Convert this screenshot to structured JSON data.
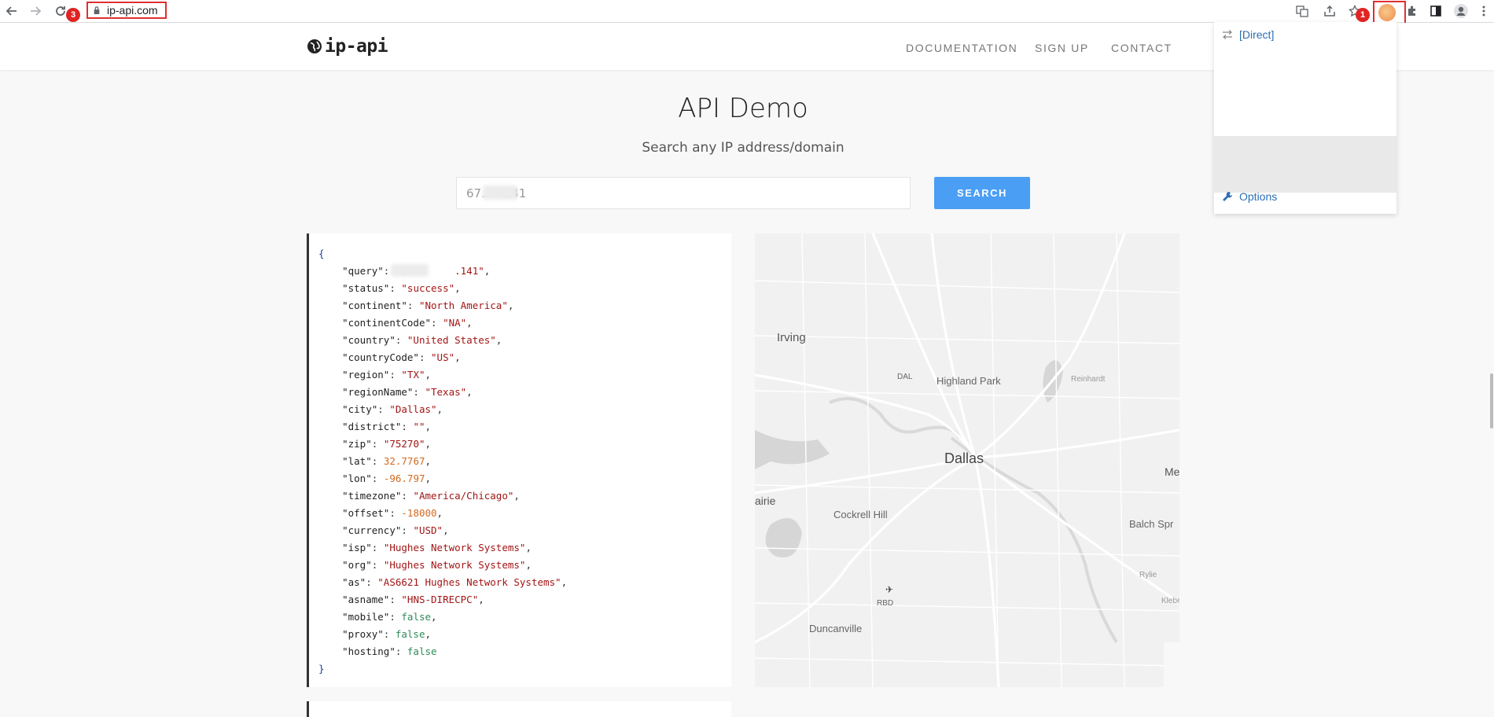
{
  "browser": {
    "url": "ip-api.com",
    "badges": {
      "url_badge": "3",
      "extension_badge": "1"
    }
  },
  "header": {
    "logo_text": "ip-api",
    "nav": [
      {
        "label": "DOCUMENTATION"
      },
      {
        "label": "SIGN UP"
      },
      {
        "label": "CONTACT"
      }
    ]
  },
  "main": {
    "title": "API Demo",
    "subtitle": "Search any IP address/domain",
    "search": {
      "value": "67.    .141",
      "button": "SEARCH"
    }
  },
  "json_result": {
    "open": "{",
    "close": "}",
    "fields": [
      {
        "key": "\"query\"",
        "value": "\"67.      .141\"",
        "type": "s",
        "comma": ","
      },
      {
        "key": "\"status\"",
        "value": "\"success\"",
        "type": "s",
        "comma": ","
      },
      {
        "key": "\"continent\"",
        "value": "\"North America\"",
        "type": "s",
        "comma": ","
      },
      {
        "key": "\"continentCode\"",
        "value": "\"NA\"",
        "type": "s",
        "comma": ","
      },
      {
        "key": "\"country\"",
        "value": "\"United States\"",
        "type": "s",
        "comma": ","
      },
      {
        "key": "\"countryCode\"",
        "value": "\"US\"",
        "type": "s",
        "comma": ","
      },
      {
        "key": "\"region\"",
        "value": "\"TX\"",
        "type": "s",
        "comma": ","
      },
      {
        "key": "\"regionName\"",
        "value": "\"Texas\"",
        "type": "s",
        "comma": ","
      },
      {
        "key": "\"city\"",
        "value": "\"Dallas\"",
        "type": "s",
        "comma": ","
      },
      {
        "key": "\"district\"",
        "value": "\"\"",
        "type": "s",
        "comma": ","
      },
      {
        "key": "\"zip\"",
        "value": "\"75270\"",
        "type": "s",
        "comma": ","
      },
      {
        "key": "\"lat\"",
        "value": "32.7767",
        "type": "n",
        "comma": ","
      },
      {
        "key": "\"lon\"",
        "value": "-96.797",
        "type": "n",
        "comma": ","
      },
      {
        "key": "\"timezone\"",
        "value": "\"America/Chicago\"",
        "type": "s",
        "comma": ","
      },
      {
        "key": "\"offset\"",
        "value": "-18000",
        "type": "n",
        "comma": ","
      },
      {
        "key": "\"currency\"",
        "value": "\"USD\"",
        "type": "s",
        "comma": ","
      },
      {
        "key": "\"isp\"",
        "value": "\"Hughes Network Systems\"",
        "type": "s",
        "comma": ","
      },
      {
        "key": "\"org\"",
        "value": "\"Hughes Network Systems\"",
        "type": "s",
        "comma": ","
      },
      {
        "key": "\"as\"",
        "value": "\"AS6621 Hughes Network Systems\"",
        "type": "s",
        "comma": ","
      },
      {
        "key": "\"asname\"",
        "value": "\"HNS-DIRECPC\"",
        "type": "s",
        "comma": ","
      },
      {
        "key": "\"mobile\"",
        "value": "false",
        "type": "b",
        "comma": ","
      },
      {
        "key": "\"proxy\"",
        "value": "false",
        "type": "b",
        "comma": ","
      },
      {
        "key": "\"hosting\"",
        "value": "false",
        "type": "b",
        "comma": ""
      }
    ]
  },
  "map": {
    "labels": {
      "irving": "Irving",
      "dal": "DAL",
      "highland_park": "Highland Park",
      "reinhardt": "Reinhardt",
      "dallas": "Dallas",
      "mesquite_partial": "Me",
      "prairie_partial": "airie",
      "cockrell_hill": "Cockrell Hill",
      "balch_springs_partial": "Balch Spr",
      "rylie": "Rylie",
      "rbd": "RBD",
      "kleberg_partial": "Klebe",
      "duncanville": "Duncanville"
    }
  },
  "proxy_popup": {
    "direct": "[Direct]",
    "options": "Options"
  },
  "colors": {
    "accent": "#4a9ff5",
    "highlight_box": "#e03030",
    "badge": "#e02424"
  }
}
